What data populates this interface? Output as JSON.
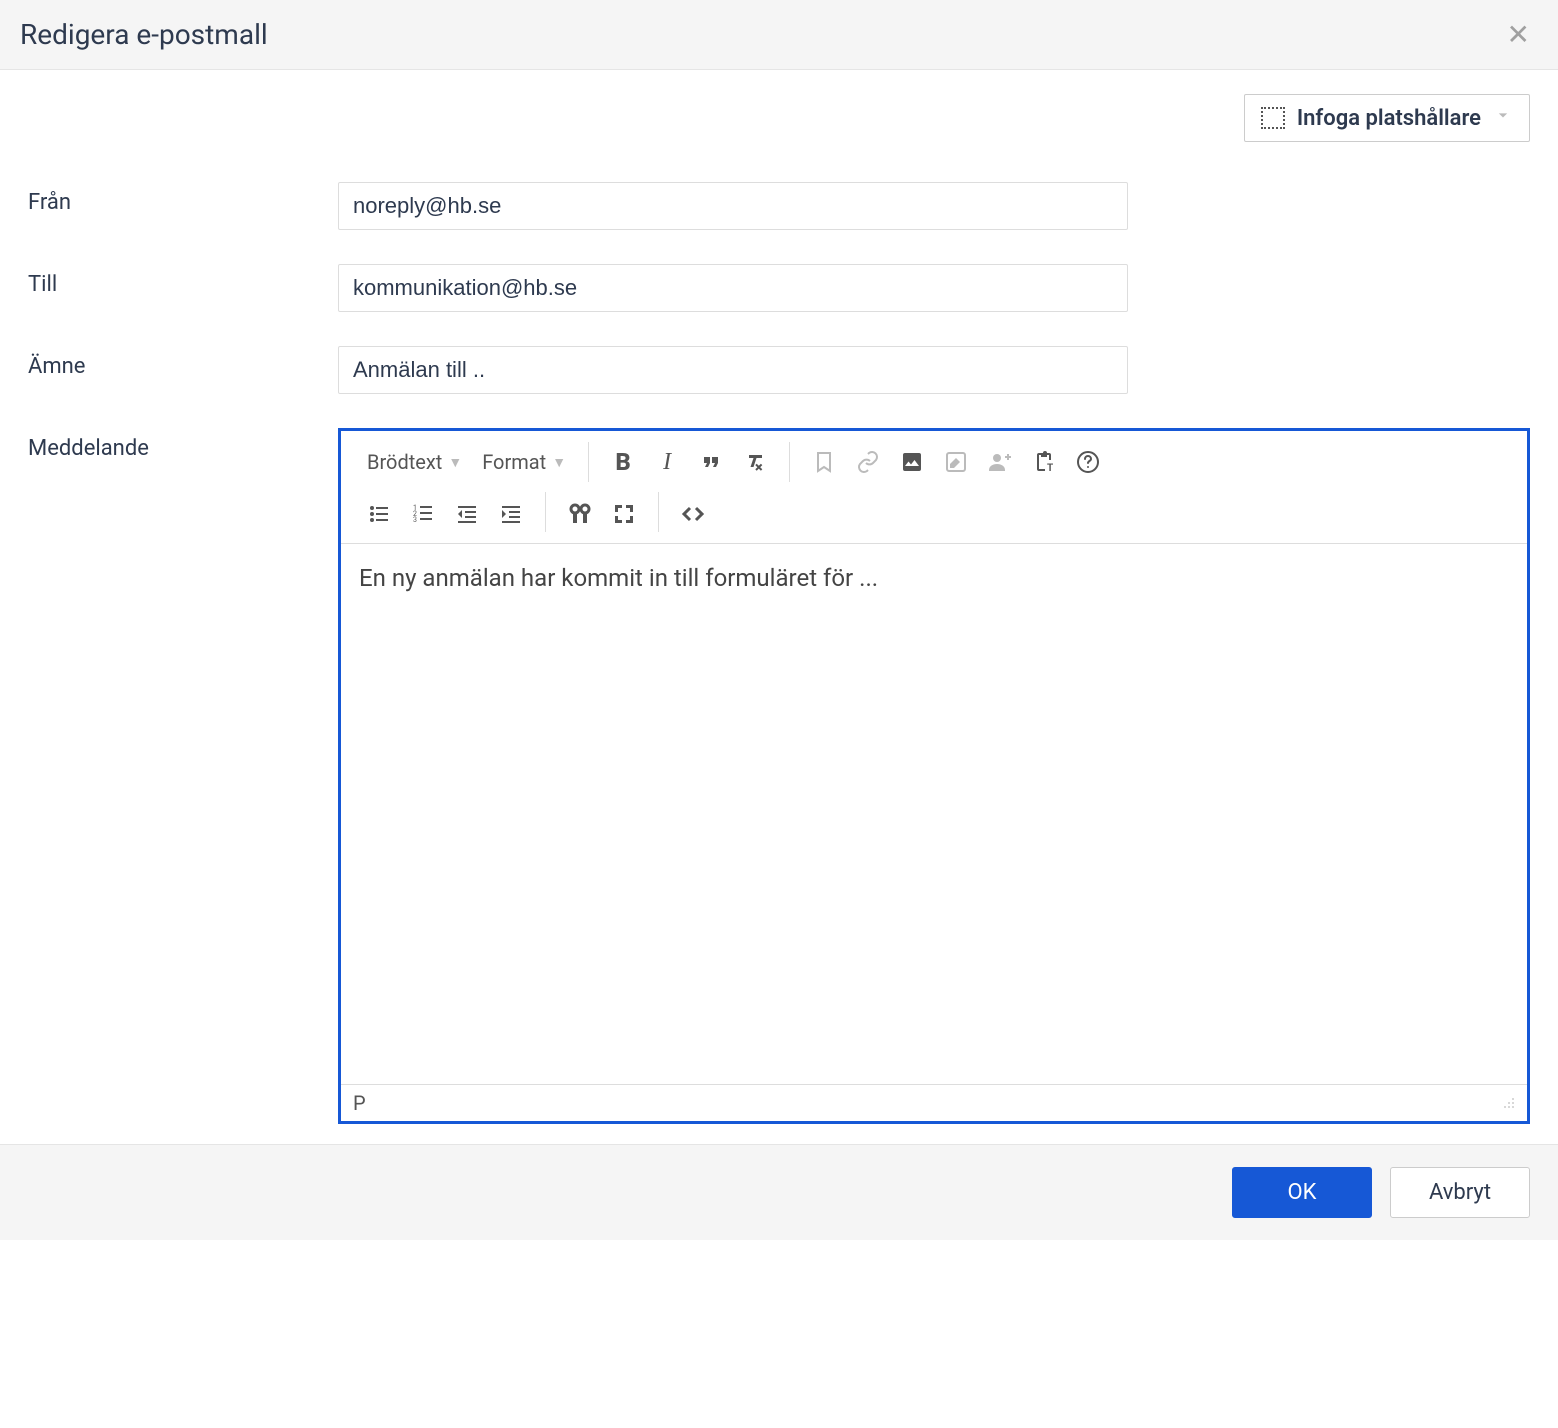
{
  "header": {
    "title": "Redigera e-postmall"
  },
  "top_action": {
    "insert_placeholder_label": "Infoga platshållare"
  },
  "form": {
    "from_label": "Från",
    "from_value": "noreply@hb.se",
    "to_label": "Till",
    "to_value": "kommunikation@hb.se",
    "subject_label": "Ämne",
    "subject_value": "Anmälan till ..",
    "message_label": "Meddelande"
  },
  "editor": {
    "paragraph_dropdown": "Brödtext",
    "format_dropdown": "Format",
    "body_text": "En ny anmälan har kommit in till formuläret för ...",
    "status_path": "P"
  },
  "footer": {
    "ok_label": "OK",
    "cancel_label": "Avbryt"
  }
}
